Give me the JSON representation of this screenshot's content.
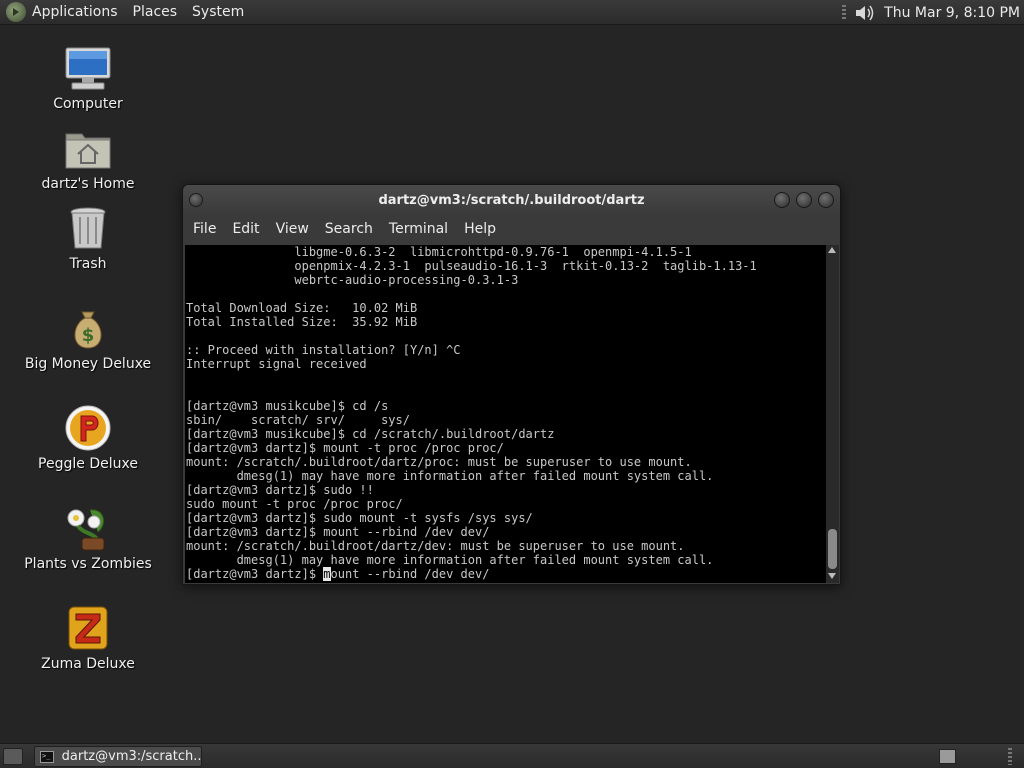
{
  "top_panel": {
    "menus": [
      "Applications",
      "Places",
      "System"
    ],
    "clock": "Thu Mar  9,  8:10 PM",
    "icons": [
      "gnome-foot-icon",
      "volume-icon"
    ]
  },
  "desktop_icons": [
    {
      "label": "Computer",
      "icon": "computer-icon"
    },
    {
      "label": "dartz's Home",
      "icon": "home-folder-icon"
    },
    {
      "label": "Trash",
      "icon": "trash-icon"
    },
    {
      "label": "Big Money Deluxe",
      "icon": "money-bag-icon"
    },
    {
      "label": "Peggle Deluxe",
      "icon": "peggle-icon"
    },
    {
      "label": "Plants vs Zombies",
      "icon": "plants-vs-zombies-icon"
    },
    {
      "label": "Zuma Deluxe",
      "icon": "zuma-icon"
    }
  ],
  "window": {
    "title": "dartz@vm3:/scratch/.buildroot/dartz",
    "menu": [
      "File",
      "Edit",
      "View",
      "Search",
      "Terminal",
      "Help"
    ],
    "terminal_lines": [
      "               libgme-0.6.3-2  libmicrohttpd-0.9.76-1  openmpi-4.1.5-1",
      "               openpmix-4.2.3-1  pulseaudio-16.1-3  rtkit-0.13-2  taglib-1.13-1",
      "               webrtc-audio-processing-0.3.1-3",
      "",
      "Total Download Size:   10.02 MiB",
      "Total Installed Size:  35.92 MiB",
      "",
      ":: Proceed with installation? [Y/n] ^C",
      "Interrupt signal received",
      "",
      "",
      "[dartz@vm3 musikcube]$ cd /s",
      "sbin/    scratch/ srv/     sys/",
      "[dartz@vm3 musikcube]$ cd /scratch/.buildroot/dartz",
      "[dartz@vm3 dartz]$ mount -t proc /proc proc/",
      "mount: /scratch/.buildroot/dartz/proc: must be superuser to use mount.",
      "       dmesg(1) may have more information after failed mount system call.",
      "[dartz@vm3 dartz]$ sudo !!",
      "sudo mount -t proc /proc proc/",
      "[dartz@vm3 dartz]$ sudo mount -t sysfs /sys sys/",
      "[dartz@vm3 dartz]$ mount --rbind /dev dev/",
      "mount: /scratch/.buildroot/dartz/dev: must be superuser to use mount.",
      "       dmesg(1) may have more information after failed mount system call."
    ],
    "prompt_line": {
      "prompt": "[dartz@vm3 dartz]$ ",
      "cursor_char": "m",
      "rest": "ount --rbind /dev dev/"
    }
  },
  "bottom_panel": {
    "task_label": "dartz@vm3:/scratch...",
    "task_icon_text": ">_"
  }
}
